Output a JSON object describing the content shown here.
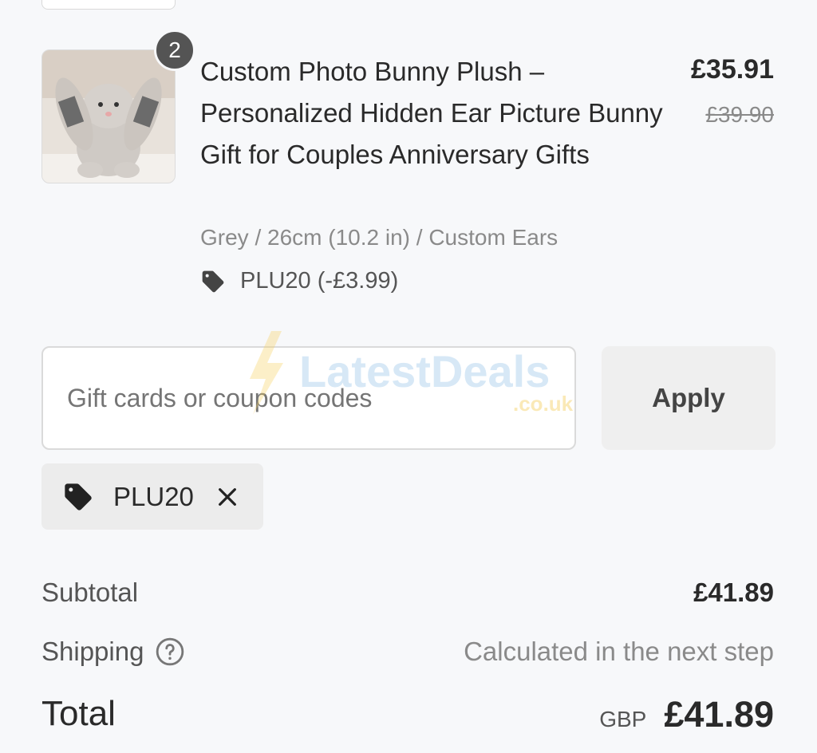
{
  "product": {
    "quantity": "2",
    "title": "Custom Photo Bunny Plush – Personalized Hidden Ear Picture Bunny Gift for Couples Anniversary Gifts",
    "variant": "Grey / 26cm (10.2 in) / Custom Ears",
    "discount_line": "PLU20 (-£3.99)",
    "price": "£35.91",
    "original_price": "£39.90"
  },
  "coupon": {
    "placeholder": "Gift cards or coupon codes",
    "apply_label": "Apply",
    "applied_code": "PLU20"
  },
  "watermark": {
    "brand": "LatestDeals",
    "domain": ".co.uk"
  },
  "summary": {
    "subtotal_label": "Subtotal",
    "subtotal_value": "£41.89",
    "shipping_label": "Shipping",
    "shipping_value": "Calculated in the next step",
    "total_label": "Total",
    "currency": "GBP",
    "total_value": "£41.89"
  },
  "icons": {
    "tag": "tag-icon",
    "close": "close-icon",
    "help": "question-circle-icon"
  },
  "colors": {
    "background": "#f7f8fa",
    "badge": "#545454",
    "muted_text": "#8a8a8a"
  }
}
